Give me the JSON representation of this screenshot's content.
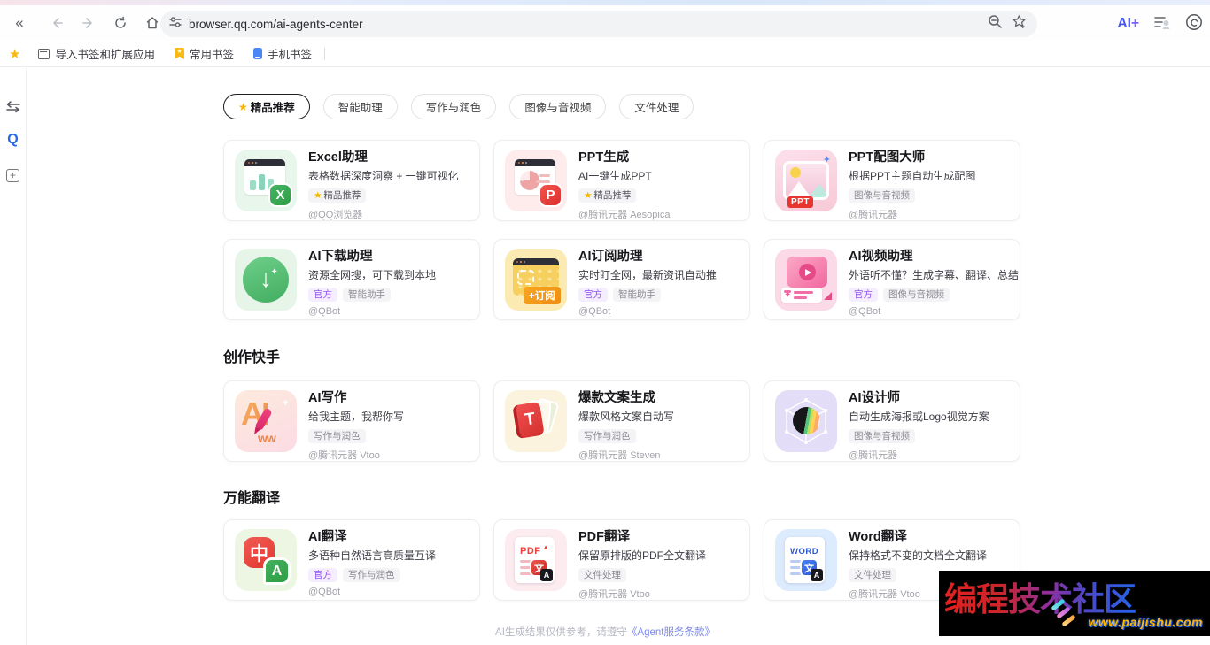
{
  "browser": {
    "url": "browser.qq.com/ai-agents-center",
    "ai_button": "AI",
    "ai_button_plus": "+",
    "bookmarks": {
      "import_label": "导入书签和扩展应用",
      "common_label": "常用书签",
      "phone_label": "手机书签"
    },
    "sidebar_q": "Q"
  },
  "tabs": [
    {
      "label": "精品推荐",
      "selected": true
    },
    {
      "label": "智能助理",
      "selected": false
    },
    {
      "label": "写作与润色",
      "selected": false
    },
    {
      "label": "图像与音视频",
      "selected": false
    },
    {
      "label": "文件处理",
      "selected": false
    }
  ],
  "sections": {
    "creation": "创作快手",
    "translation": "万能翻译"
  },
  "cards": {
    "excel": {
      "title": "Excel助理",
      "desc": "表格数据深度洞察 + 一键可视化",
      "badge_star": "精品推荐",
      "author": "@QQ浏览器",
      "glyph": "X"
    },
    "pptgen": {
      "title": "PPT生成",
      "desc": "AI一键生成PPT",
      "badge_star": "精品推荐",
      "author": "@腾讯元器 Aesopica",
      "glyph": "P"
    },
    "pptimg": {
      "title": "PPT配图大师",
      "desc": "根据PPT主题自动生成配图",
      "badge": "图像与音视频",
      "author": "@腾讯元器",
      "glyph": "PPT"
    },
    "download": {
      "title": "AI下载助理",
      "desc": "资源全网搜，可下载到本地",
      "badge_official": "官方",
      "badge": "智能助手",
      "author": "@QBot",
      "glyph": "↓"
    },
    "subscribe": {
      "title": "AI订阅助理",
      "desc": "实时盯全网，最新资讯自动推",
      "badge_official": "官方",
      "badge": "智能助手",
      "author": "@QBot",
      "glyph": "+订阅"
    },
    "video": {
      "title": "AI视频助理",
      "desc": "外语听不懂？生成字幕、翻译、总结",
      "badge_official": "官方",
      "badge": "图像与音视频",
      "author": "@QBot"
    },
    "writing": {
      "title": "AI写作",
      "desc": "给我主题，我帮你写",
      "badge": "写作与润色",
      "author": "@腾讯元器 Vtoo",
      "glyph": "AI",
      "squiggle": "ww"
    },
    "copywriting": {
      "title": "爆款文案生成",
      "desc": "爆款风格文案自动写",
      "badge": "写作与润色",
      "author": "@腾讯元器 Steven",
      "glyph": "T"
    },
    "designer": {
      "title": "AI设计师",
      "desc": "自动生成海报或Logo视觉方案",
      "badge": "图像与音视频",
      "author": "@腾讯元器"
    },
    "translate": {
      "title": "AI翻译",
      "desc": "多语种自然语言高质量互译",
      "badge_official": "官方",
      "badge": "写作与润色",
      "author": "@QBot",
      "glyph_zh": "中",
      "glyph_en": "A"
    },
    "pdf": {
      "title": "PDF翻译",
      "desc": "保留原排版的PDF全文翻译",
      "badge": "文件处理",
      "author": "@腾讯元器 Vtoo",
      "glyph": "PDF",
      "glyph_zh": "文",
      "glyph_en": "A",
      "glyph_tri": "▲"
    },
    "word": {
      "title": "Word翻译",
      "desc": "保持格式不变的文档全文翻译",
      "badge": "文件处理",
      "author": "@腾讯元器 Vtoo",
      "glyph": "WORD",
      "glyph_zh": "文",
      "glyph_en": "A"
    }
  },
  "footer": {
    "disclaimer": "AI生成结果仅供参考，请遵守",
    "terms_link": "《Agent服务条款》"
  },
  "watermark": {
    "text": "编程技术社区",
    "url": "www.paijishu.com"
  }
}
